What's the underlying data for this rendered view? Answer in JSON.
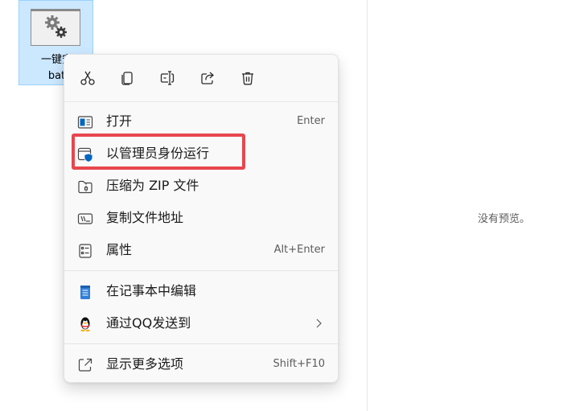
{
  "file_item": {
    "name_line1": "一键安",
    "name_line2": "bat"
  },
  "preview": {
    "empty_text": "没有预览。"
  },
  "context_menu": {
    "quick_actions": [
      {
        "name": "cut",
        "icon": "scissors-icon"
      },
      {
        "name": "copy",
        "icon": "copy-icon"
      },
      {
        "name": "rename",
        "icon": "rename-icon"
      },
      {
        "name": "share",
        "icon": "share-icon"
      },
      {
        "name": "delete",
        "icon": "trash-icon"
      }
    ],
    "items": [
      {
        "label": "打开",
        "shortcut": "Enter",
        "icon": "open-window-icon"
      },
      {
        "label": "以管理员身份运行",
        "shortcut": "",
        "icon": "shield-run-icon"
      },
      {
        "label": "压缩为 ZIP 文件",
        "shortcut": "",
        "icon": "zip-folder-icon"
      },
      {
        "label": "复制文件地址",
        "shortcut": "",
        "icon": "copy-path-icon"
      },
      {
        "label": "属性",
        "shortcut": "Alt+Enter",
        "icon": "properties-icon"
      },
      {
        "label": "在记事本中编辑",
        "shortcut": "",
        "icon": "notepad-icon"
      },
      {
        "label": "通过QQ发送到",
        "shortcut": "",
        "icon": "qq-penguin-icon",
        "submenu": true
      },
      {
        "label": "显示更多选项",
        "shortcut": "Shift+F10",
        "icon": "more-options-icon"
      }
    ]
  },
  "colors": {
    "selection_bg": "#cce8ff",
    "selection_border": "#99d1ff",
    "menu_bg": "#f9f9f9",
    "highlight_red": "#e8464e",
    "accent_blue": "#0067c0"
  }
}
